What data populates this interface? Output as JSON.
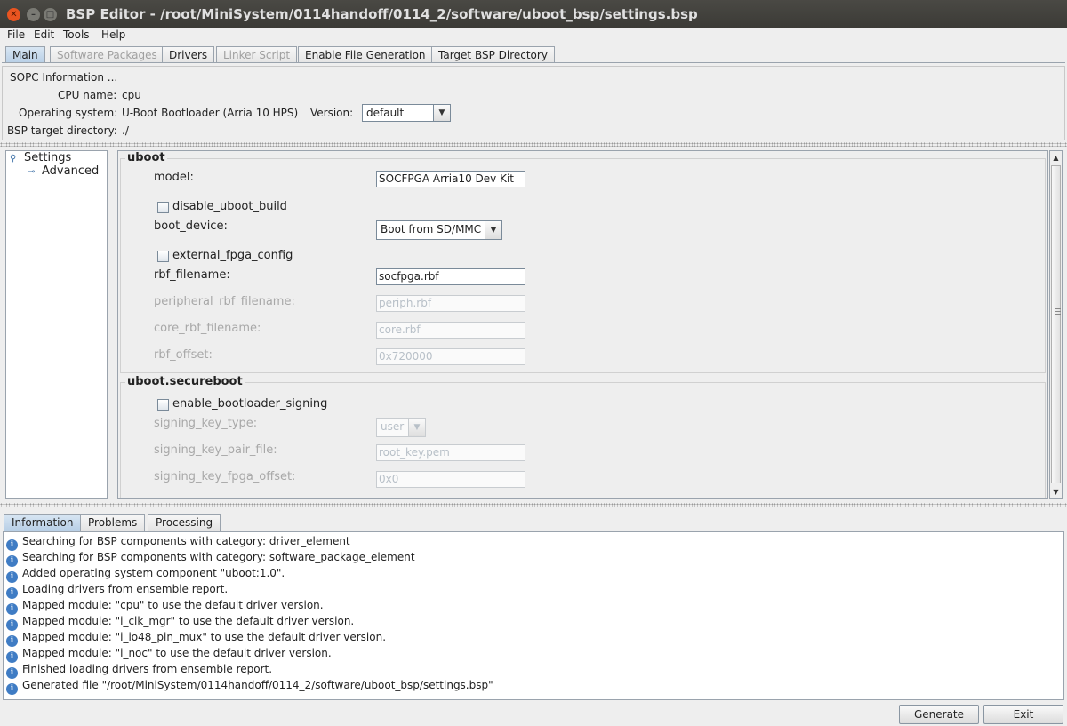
{
  "window": {
    "title": "BSP Editor - /root/MiniSystem/0114handoff/0114_2/software/uboot_bsp/settings.bsp"
  },
  "menu": [
    "File",
    "Edit",
    "Tools",
    "Help"
  ],
  "tabs": [
    "Main",
    "Software Packages",
    "Drivers",
    "Linker Script",
    "Enable File Generation",
    "Target BSP Directory"
  ],
  "sopc": {
    "section_label": "SOPC Information ...",
    "cpu_label": "CPU name:",
    "cpu_value": "cpu",
    "os_label": "Operating system:",
    "os_value": "U-Boot Bootloader (Arria 10 HPS)",
    "version_label": "Version:",
    "version_value": "default",
    "bsp_dir_label": "BSP target directory:",
    "bsp_dir_value": "./"
  },
  "tree": {
    "root": "Settings",
    "child": "Advanced"
  },
  "settings": {
    "uboot": {
      "title": "uboot",
      "model_label": "model:",
      "model_value": "SOCFPGA Arria10 Dev Kit",
      "disable_build_label": "disable_uboot_build",
      "boot_device_label": "boot_device:",
      "boot_device_value": "Boot from SD/MMC",
      "external_fpga_label": "external_fpga_config",
      "rbf_filename_label": "rbf_filename:",
      "rbf_filename_value": "socfpga.rbf",
      "peripheral_rbf_label": "peripheral_rbf_filename:",
      "peripheral_rbf_value": "periph.rbf",
      "core_rbf_label": "core_rbf_filename:",
      "core_rbf_value": "core.rbf",
      "rbf_offset_label": "rbf_offset:",
      "rbf_offset_value": "0x720000"
    },
    "secureboot": {
      "title": "uboot.secureboot",
      "enable_signing_label": "enable_bootloader_signing",
      "key_type_label": "signing_key_type:",
      "key_type_value": "user",
      "key_pair_label": "signing_key_pair_file:",
      "key_pair_value": "root_key.pem",
      "fpga_offset_label": "signing_key_fpga_offset:",
      "fpga_offset_value": "0x0"
    }
  },
  "bottom_tabs": [
    "Information",
    "Problems",
    "Processing"
  ],
  "log": [
    "Searching for BSP components with category: driver_element",
    "Searching for BSP components with category: software_package_element",
    "Added operating system component \"uboot:1.0\".",
    "Loading drivers from ensemble report.",
    "Mapped module: \"cpu\" to use the default driver version.",
    "Mapped module: \"i_clk_mgr\" to use the default driver version.",
    "Mapped module: \"i_io48_pin_mux\" to use the default driver version.",
    "Mapped module: \"i_noc\" to use the default driver version.",
    "Finished loading drivers from ensemble report.",
    "Generated file \"/root/MiniSystem/0114handoff/0114_2/software/uboot_bsp/settings.bsp\""
  ],
  "buttons": {
    "generate": "Generate",
    "exit": "Exit"
  }
}
